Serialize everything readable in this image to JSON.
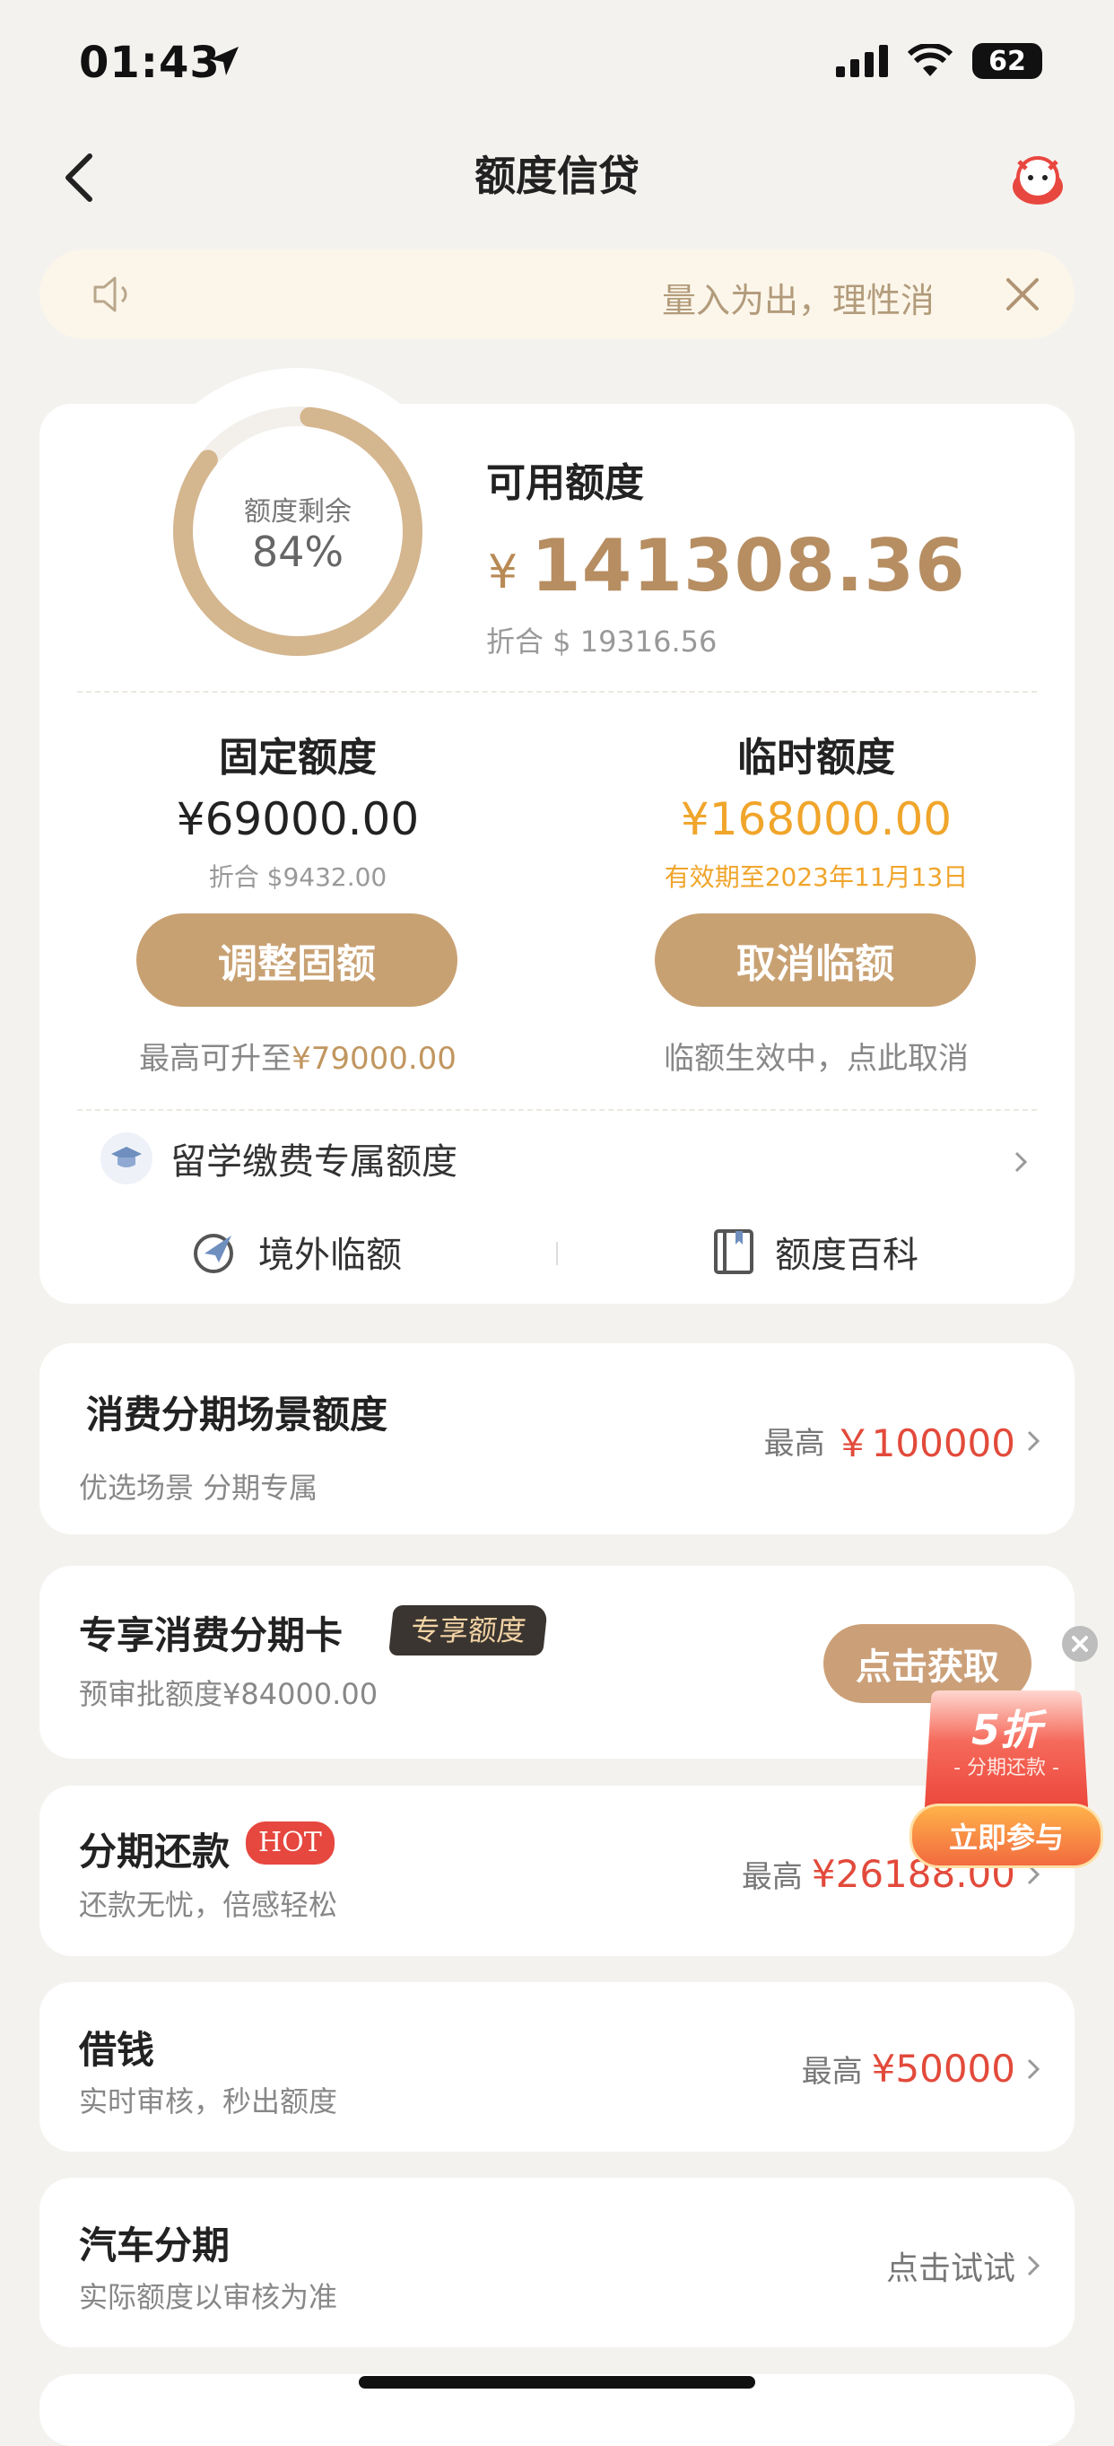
{
  "status": {
    "time": "01:43",
    "battery": "62"
  },
  "nav": {
    "title": "额度信贷"
  },
  "notice": {
    "text": "量入为出，理性消"
  },
  "quota": {
    "ring_label": "额度剩余",
    "ring_percent_text": "84%",
    "ring_percent": 0.84,
    "available_label": "可用额度",
    "currency": "¥",
    "available_amount": "141308.36",
    "available_usd": "折合 $ 19316.56"
  },
  "fixed": {
    "title": "固定额度",
    "amount": "¥69000.00",
    "usd": "折合 $9432.00",
    "button": "调整固额",
    "note_prefix": "最高可升至",
    "note_value": "¥79000.00"
  },
  "temp": {
    "title": "临时额度",
    "amount": "¥168000.00",
    "validity": "有效期至2023年11月13日",
    "button": "取消临额",
    "note": "临额生效中，点此取消"
  },
  "study": {
    "label": "留学缴费专属额度"
  },
  "links": {
    "overseas": "境外临额",
    "wiki": "额度百科"
  },
  "items": {
    "consume": {
      "title": "消费分期场景额度",
      "sub": "优选场景 分期专属",
      "pre": "最高",
      "value": "￥100000"
    },
    "card": {
      "title": "专享消费分期卡",
      "badge": "专享额度",
      "sub": "预审批额度¥84000.00",
      "button": "点击获取"
    },
    "repay": {
      "title": "分期还款",
      "badge": "HOT",
      "sub": "还款无忧，倍感轻松",
      "pre": "最高",
      "value": "¥26188.00"
    },
    "borrow": {
      "title": "借钱",
      "sub": "实时审核，秒出额度",
      "pre": "最高",
      "value": "¥50000"
    },
    "car": {
      "title": "汽车分期",
      "sub": "实际额度以审核为准",
      "action": "点击试试"
    }
  },
  "promo": {
    "discount": "5折",
    "sub": "- 分期还款 -",
    "button": "立即参与"
  },
  "colors": {
    "accent": "#c8a173",
    "red": "#e24a3b",
    "orange": "#f0a52b"
  }
}
